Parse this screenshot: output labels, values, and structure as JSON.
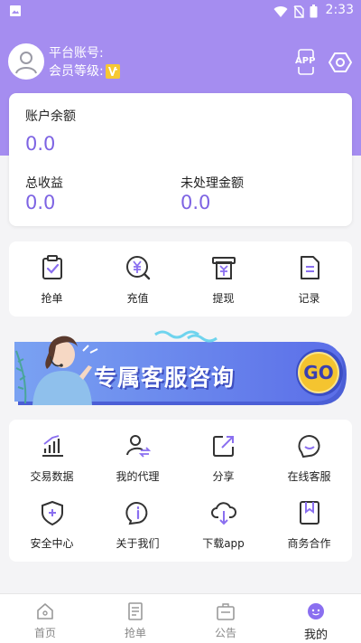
{
  "status_bar": {
    "time": "2:33"
  },
  "profile": {
    "account_label": "平台账号:",
    "level_label": "会员等级:"
  },
  "header": {
    "app_button_label": "APP"
  },
  "balance": {
    "account_balance_label": "账户余额",
    "account_balance_value": "0.0",
    "total_income_label": "总收益",
    "total_income_value": "0.0",
    "pending_amount_label": "未处理金额",
    "pending_amount_value": "0.0"
  },
  "quick_actions": [
    {
      "label": "抢单",
      "icon": "clipboard-check-icon"
    },
    {
      "label": "充值",
      "icon": "yuan-search-icon"
    },
    {
      "label": "提现",
      "icon": "printer-yuan-icon"
    },
    {
      "label": "记录",
      "icon": "document-icon"
    }
  ],
  "banner": {
    "text": "专属客服咨询",
    "go_label": "GO"
  },
  "services_row1": [
    {
      "label": "交易数据",
      "icon": "bar-chart-icon"
    },
    {
      "label": "我的代理",
      "icon": "user-swap-icon"
    },
    {
      "label": "分享",
      "icon": "share-icon"
    },
    {
      "label": "在线客服",
      "icon": "chat-face-icon"
    }
  ],
  "services_row2": [
    {
      "label": "安全中心",
      "icon": "shield-icon"
    },
    {
      "label": "关于我们",
      "icon": "info-icon"
    },
    {
      "label": "下载app",
      "icon": "cloud-download-icon"
    },
    {
      "label": "商务合作",
      "icon": "bookmark-icon"
    }
  ],
  "tabbar": [
    {
      "label": "首页",
      "icon": "home-icon"
    },
    {
      "label": "抢单",
      "icon": "list-icon"
    },
    {
      "label": "公告",
      "icon": "briefcase-icon"
    },
    {
      "label": "我的",
      "icon": "face-icon",
      "active": true
    }
  ],
  "colors": {
    "accent": "#a58df0",
    "value": "#7d63e3",
    "icon_line": "#333333"
  }
}
